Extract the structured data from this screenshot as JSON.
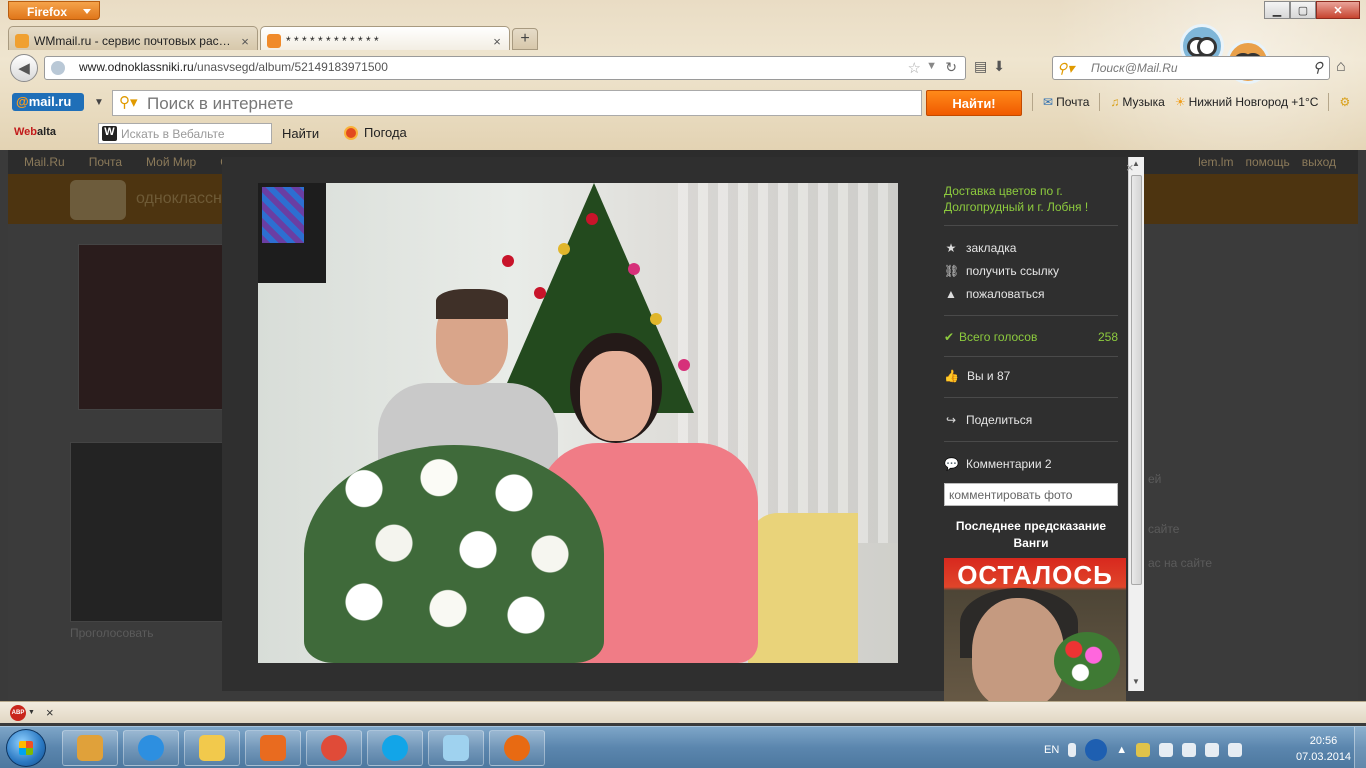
{
  "browser": {
    "menu_button": "Firefox",
    "window_controls": {
      "minimize": "▁",
      "maximize": "▢",
      "close": "✕"
    },
    "tabs": [
      {
        "label": "WMmail.ru - сервис почтовых расс...",
        "favicon_color": "#f0a030"
      },
      {
        "label": "* * * * * * * * * * * *",
        "favicon_color": "#f08a2a"
      }
    ],
    "new_tab": "+",
    "tab_close": "×",
    "back": "◀",
    "url_host": "www.odnoklassniki.ru",
    "url_path": "/unasvsegd/album/52149183971500",
    "search_placeholder": "Поиск@Mail.Ru",
    "search_engine_icon": "search-engine-icon",
    "home_icon": "⌂"
  },
  "mailru_toolbar": {
    "logo_at": "@",
    "logo_text": "mail.ru",
    "search_placeholder": "Поиск в интернете",
    "search_button": "Найти!",
    "links": [
      {
        "label": "Почта",
        "icon": "✉"
      },
      {
        "label": "Музыка",
        "icon": "♫"
      },
      {
        "label": "Нижний Новгород +1°C",
        "icon": "☀"
      }
    ]
  },
  "webalta_toolbar": {
    "logo_prefix": "Web",
    "logo_suffix": "alta",
    "search_placeholder": "Искать в Вебальте",
    "input_badge": "W",
    "find_button": "Найти",
    "weather_label": "Погода"
  },
  "page": {
    "nav_left": [
      "Mail.Ru",
      "Почта",
      "Мой Мир",
      "Од"
    ],
    "nav_right": [
      "lem.lm",
      "помощь",
      "выход"
    ],
    "site_title": "одноклассн",
    "vote_dim": "Проголосовать",
    "side_dim": [
      "ей",
      "сайте",
      "ас на сайте"
    ]
  },
  "modal": {
    "ad_link": "Доставка цветов по г. Долгопрудный и г. Лобня !",
    "actions": [
      {
        "icon": "★",
        "label": "закладка"
      },
      {
        "icon": "🔗",
        "label": "получить ссылку"
      },
      {
        "icon": "▲",
        "label": "пожаловаться"
      }
    ],
    "votes_label": "Всего голосов",
    "votes_count": "258",
    "likes_label": "Вы и 87",
    "share_label": "Поделиться",
    "comments_label": "Комментарии 2",
    "comment_placeholder": "комментировать фото",
    "promo_title": "Последнее предсказание Ванги",
    "promo_headline": "ОСТАЛОСЬ",
    "close": "×"
  },
  "addonbar": {
    "abp_label": "ABP",
    "close": "×"
  },
  "taskbar": {
    "lang": "EN",
    "time": "20:56",
    "date": "07.03.2014",
    "pinned": [
      {
        "name": "folder-app",
        "color": "#e0a13a"
      },
      {
        "name": "internet-explorer",
        "color": "#2d8fe0"
      },
      {
        "name": "explorer-folder",
        "color": "#f2c94c"
      },
      {
        "name": "media-player",
        "color": "#e96b1f"
      },
      {
        "name": "chrome",
        "color": "#e04b38"
      },
      {
        "name": "skype",
        "color": "#12a5e8"
      },
      {
        "name": "notepad",
        "color": "#9fd2ef"
      },
      {
        "name": "firefox",
        "color": "#e86a12"
      }
    ]
  }
}
